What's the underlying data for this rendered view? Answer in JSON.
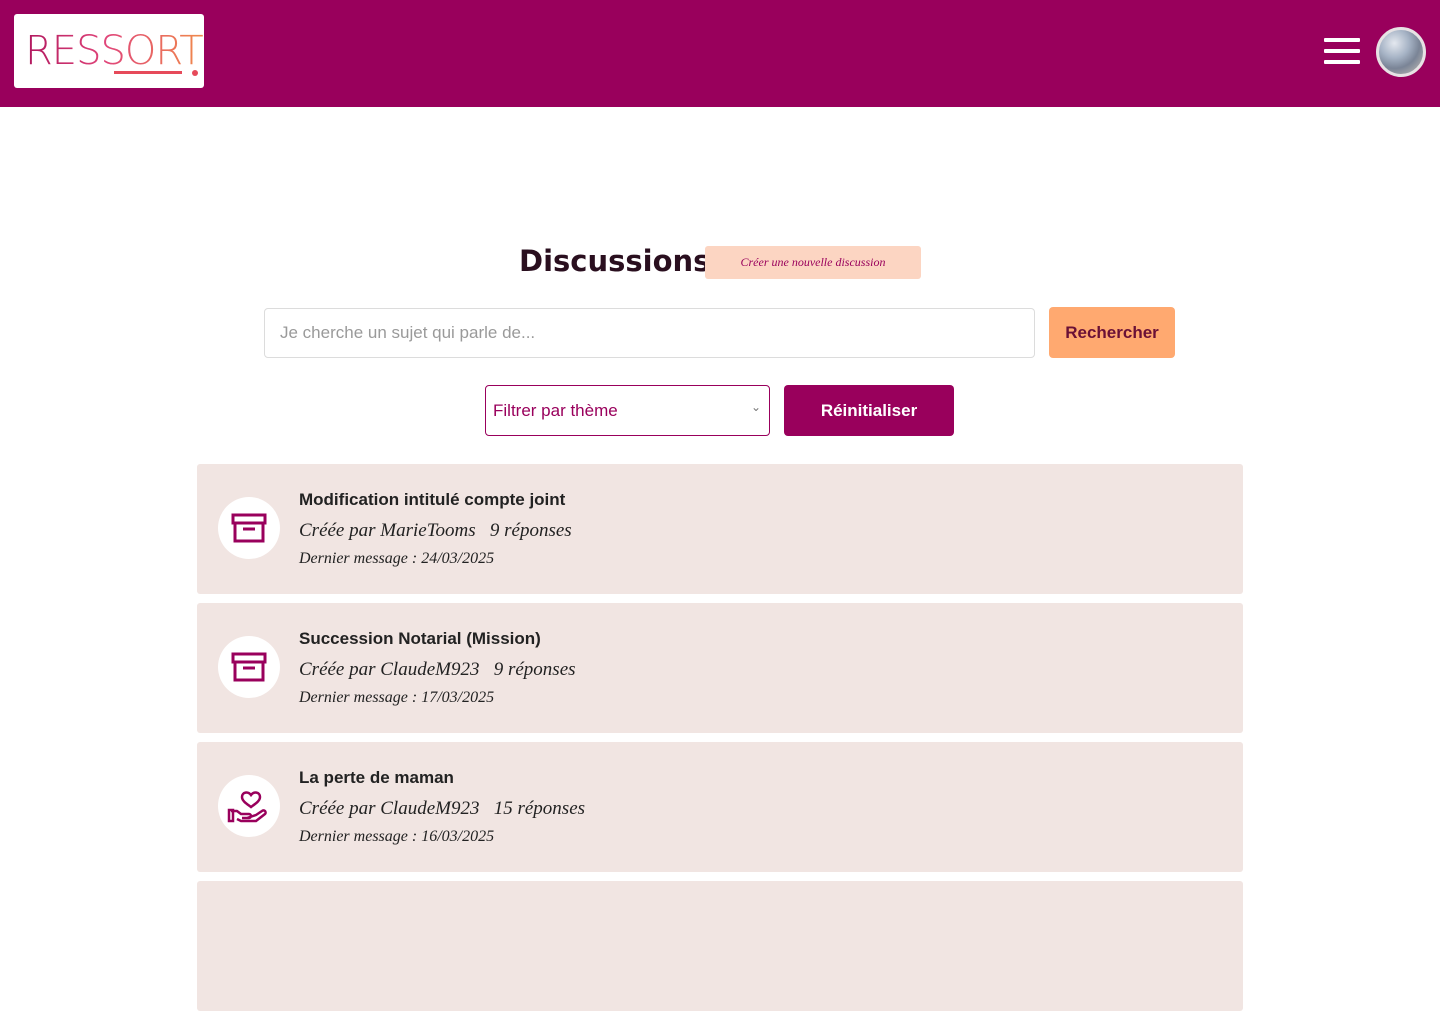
{
  "header": {
    "logo_text": "RESSORT",
    "accent_color": "#99005c"
  },
  "main": {
    "title": "Discussions",
    "new_discussion_label": "Créer une nouvelle discussion",
    "search": {
      "placeholder": "Je cherche un sujet qui parle de...",
      "value": "",
      "button_label": "Rechercher"
    },
    "filter": {
      "selected": "Filtrer par thème",
      "reset_label": "Réinitialiser"
    },
    "discussions": [
      {
        "title": "Modification intitulé compte joint",
        "author": "Créée par MarieTooms",
        "replies": "9 réponses",
        "last_message": "Dernier message : 24/03/2025",
        "icon": "archive-icon"
      },
      {
        "title": "Succession Notarial  (Mission)",
        "author": "Créée par ClaudeM923",
        "replies": "9 réponses",
        "last_message": "Dernier message : 17/03/2025",
        "icon": "archive-icon"
      },
      {
        "title": "La perte de maman",
        "author": "Créée par ClaudeM923",
        "replies": "15 réponses",
        "last_message": "Dernier message : 16/03/2025",
        "icon": "heart-hand-icon"
      }
    ]
  }
}
